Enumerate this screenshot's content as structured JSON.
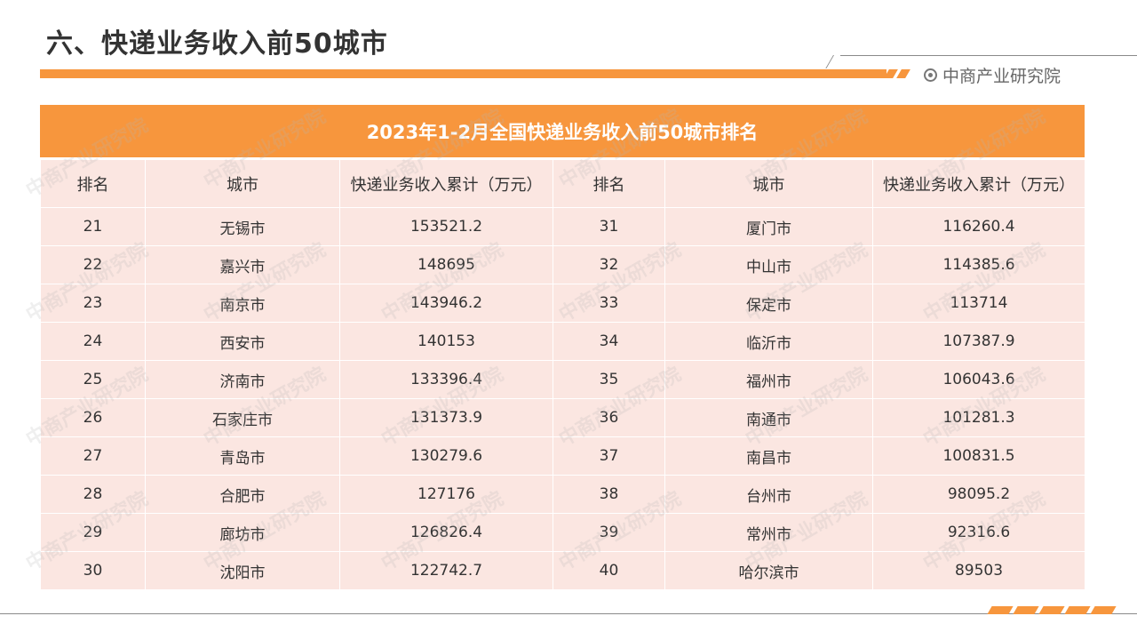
{
  "page_title": "六、快递业务收入前50城市",
  "brand": "中商产业研究院",
  "watermark": "中商产业研究院",
  "colors": {
    "accent": "#f7963d",
    "row_fill": "#fbe6e1"
  },
  "table": {
    "title": "2023年1-2月全国快递业务收入前50城市排名",
    "headers": [
      "排名",
      "城市",
      "快递业务收入累计（万元）",
      "排名",
      "城市",
      "快递业务收入累计（万元）"
    ],
    "rows": [
      [
        "21",
        "无锡市",
        "153521.2",
        "31",
        "厦门市",
        "116260.4"
      ],
      [
        "22",
        "嘉兴市",
        "148695",
        "32",
        "中山市",
        "114385.6"
      ],
      [
        "23",
        "南京市",
        "143946.2",
        "33",
        "保定市",
        "113714"
      ],
      [
        "24",
        "西安市",
        "140153",
        "34",
        "临沂市",
        "107387.9"
      ],
      [
        "25",
        "济南市",
        "133396.4",
        "35",
        "福州市",
        "106043.6"
      ],
      [
        "26",
        "石家庄市",
        "131373.9",
        "36",
        "南通市",
        "101281.3"
      ],
      [
        "27",
        "青岛市",
        "130279.6",
        "37",
        "南昌市",
        "100831.5"
      ],
      [
        "28",
        "合肥市",
        "127176",
        "38",
        "台州市",
        "98095.2"
      ],
      [
        "29",
        "廊坊市",
        "126826.4",
        "39",
        "常州市",
        "92316.6"
      ],
      [
        "30",
        "沈阳市",
        "122742.7",
        "40",
        "哈尔滨市",
        "89503"
      ]
    ]
  }
}
